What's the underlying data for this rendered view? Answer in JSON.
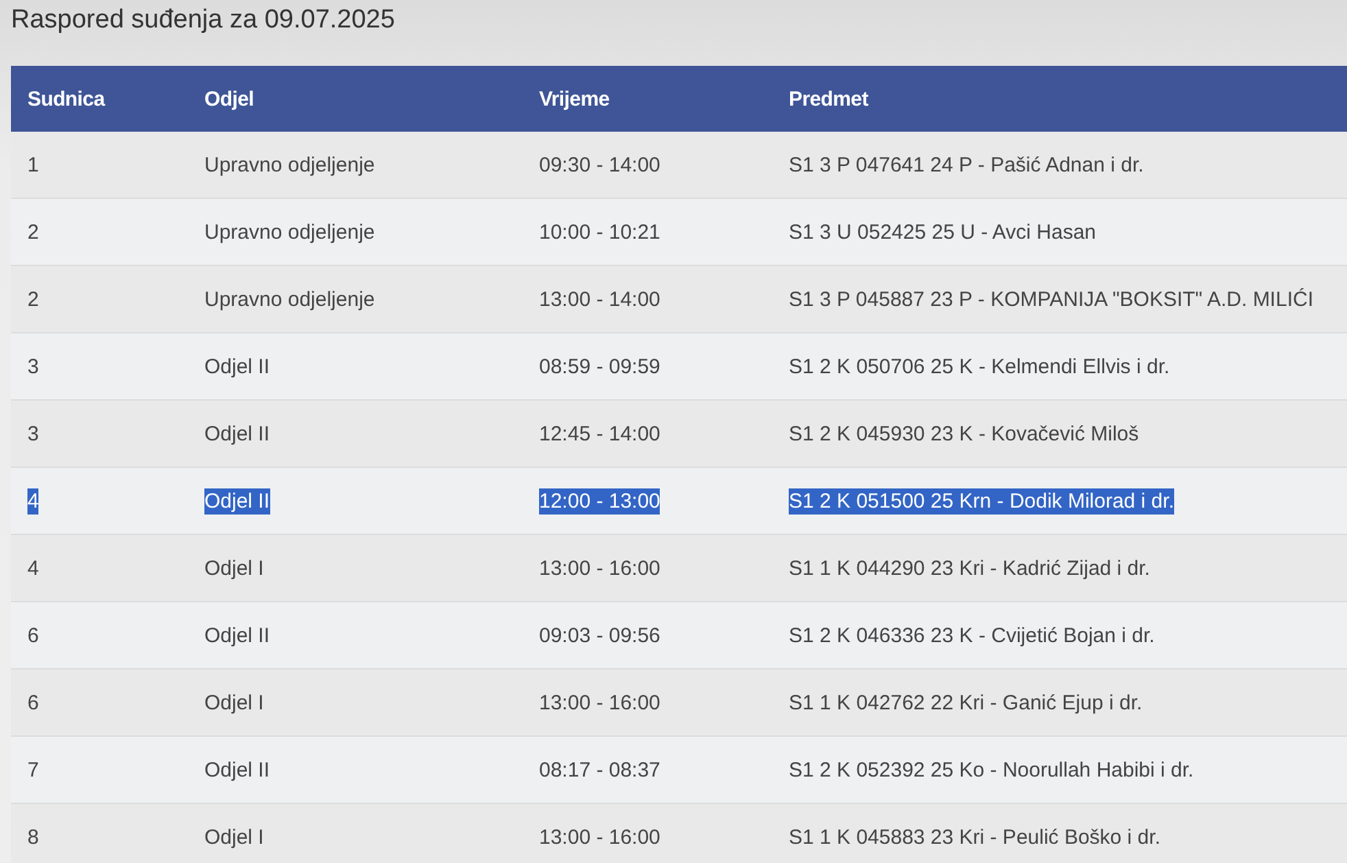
{
  "title": "Raspored suđenja za 09.07.2025",
  "table": {
    "columns": [
      "Sudnica",
      "Odjel",
      "Vrijeme",
      "Predmet"
    ],
    "rows": [
      {
        "cells": [
          "1",
          "Upravno odjeljenje",
          "09:30 - 14:00",
          "S1 3 P 047641 24 P - Pašić Adnan i dr."
        ],
        "selected": false
      },
      {
        "cells": [
          "2",
          "Upravno odjeljenje",
          "10:00 - 10:21",
          "S1 3 U 052425 25 U - Avci Hasan"
        ],
        "selected": false
      },
      {
        "cells": [
          "2",
          "Upravno odjeljenje",
          "13:00 - 14:00",
          "S1 3 P 045887 23 P - KOMPANIJA \"BOKSIT\" A.D. MILIĆI"
        ],
        "selected": false
      },
      {
        "cells": [
          "3",
          "Odjel II",
          "08:59 - 09:59",
          "S1 2 K 050706 25 K - Kelmendi Ellvis i dr."
        ],
        "selected": false
      },
      {
        "cells": [
          "3",
          "Odjel II",
          "12:45 - 14:00",
          "S1 2 K 045930 23 K - Kovačević Miloš"
        ],
        "selected": false
      },
      {
        "cells": [
          "4",
          "Odjel II",
          "12:00 - 13:00",
          "S1 2 K 051500 25 Krn - Dodik Milorad i dr."
        ],
        "selected": true
      },
      {
        "cells": [
          "4",
          "Odjel I",
          "13:00 - 16:00",
          "S1 1 K 044290 23 Kri - Kadrić Zijad i dr."
        ],
        "selected": false
      },
      {
        "cells": [
          "6",
          "Odjel II",
          "09:03 - 09:56",
          "S1 2 K 046336 23 K - Cvijetić Bojan i dr."
        ],
        "selected": false
      },
      {
        "cells": [
          "6",
          "Odjel I",
          "13:00 - 16:00",
          "S1 1 K 042762 22 Kri - Ganić Ejup i dr."
        ],
        "selected": false
      },
      {
        "cells": [
          "7",
          "Odjel II",
          "08:17 - 08:37",
          "S1 2 K 052392 25 Ko - Noorullah Habibi i dr."
        ],
        "selected": false
      },
      {
        "cells": [
          "8",
          "Odjel I",
          "13:00 - 16:00",
          "S1 1 K 045883 23 Kri - Peulić Boško i dr."
        ],
        "selected": false
      }
    ]
  }
}
